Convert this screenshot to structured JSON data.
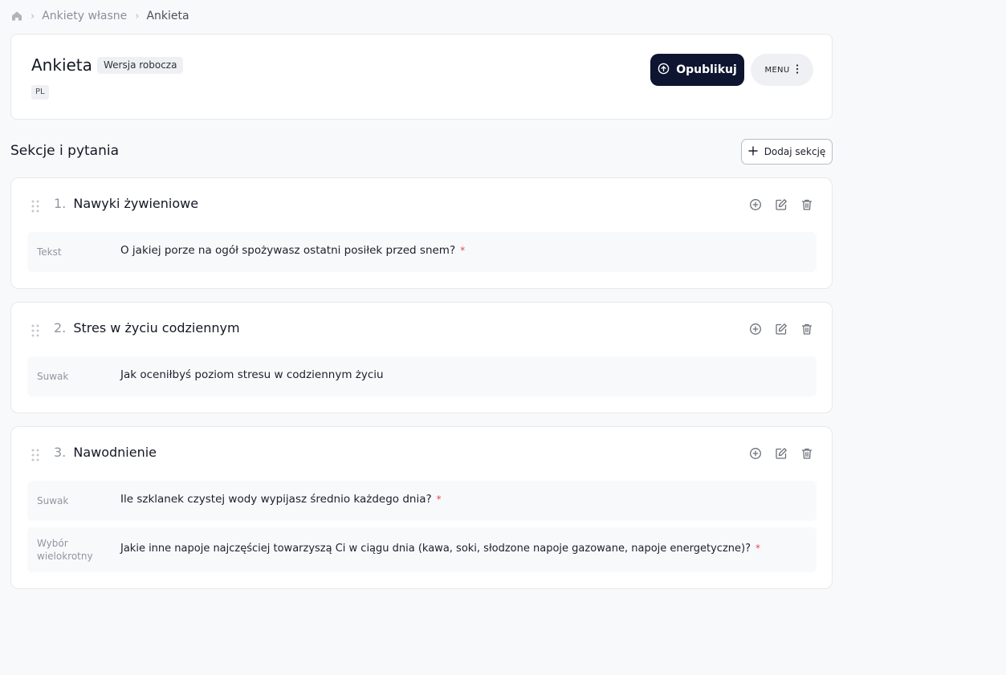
{
  "breadcrumb": {
    "parent": "Ankiety własne",
    "current": "Ankieta"
  },
  "header": {
    "title": "Ankieta",
    "status_badge": "Wersja robocza",
    "language": "PL",
    "publish_label": "Opublikuj",
    "menu_label": "MENU"
  },
  "sections_heading": "Sekcje i pytania",
  "add_section_label": "Dodaj sekcję",
  "sections": [
    {
      "number": "1.",
      "title": "Nawyki żywieniowe",
      "questions": [
        {
          "type": "Tekst",
          "text": "O jakiej porze na ogół spożywasz ostatni posiłek przed snem?",
          "required": "*"
        }
      ]
    },
    {
      "number": "2.",
      "title": "Stres w życiu codziennym",
      "questions": [
        {
          "type": "Suwak",
          "text": "Jak oceniłbyś poziom stresu w codziennym życiu",
          "required": ""
        }
      ]
    },
    {
      "number": "3.",
      "title": "Nawodnienie",
      "questions": [
        {
          "type": "Suwak",
          "text": "Ile szklanek czystej wody wypijasz średnio każdego dnia?",
          "required": "*"
        },
        {
          "type_line1": "Wybór",
          "type_line2": "wielokrotny",
          "text": "Jakie inne napoje najczęściej towarzyszą Ci w ciągu dnia (kawa, soki, słodzone napoje gazowane, napoje energetyczne)?",
          "required": "*"
        }
      ]
    }
  ],
  "colors": {
    "primary": "#0d1530",
    "required": "#e5484d",
    "background": "#f8f9fb"
  }
}
